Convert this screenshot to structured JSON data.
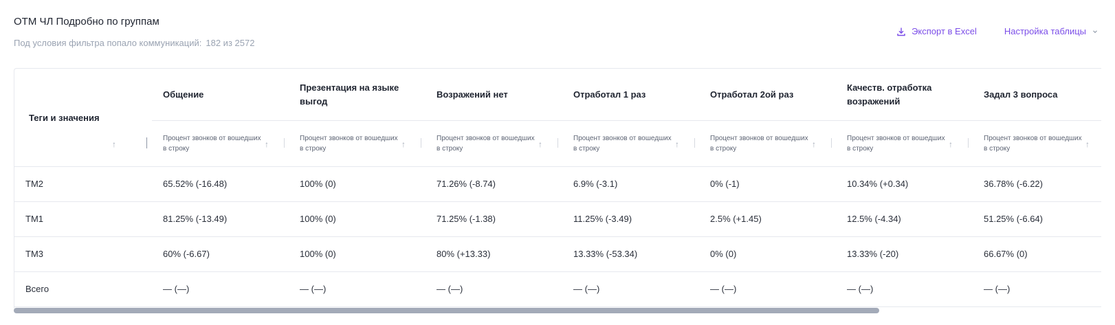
{
  "header": {
    "title": "ОТМ ЧЛ Подробно по группам",
    "filter_text": "Под условия фильтра попало коммуникаций:",
    "filter_count": "182 из 2572"
  },
  "actions": {
    "export_label": "Экспорт в Excel",
    "settings_label": "Настройка таблицы"
  },
  "colors": {
    "accent": "#7b4de8",
    "muted": "#9aa3b2",
    "border": "#e6e8ee",
    "scrollbar": "#a3aab8"
  },
  "table": {
    "row_header_label": "Теги и значения",
    "columns": [
      {
        "title": "Общение",
        "subtitle": "Процент звонков от вошедших в строку"
      },
      {
        "title": "Презентация на языке выгод",
        "subtitle": "Процент звонков от вошедших в строку"
      },
      {
        "title": "Возражений нет",
        "subtitle": "Процент звонков от вошедших в строку"
      },
      {
        "title": "Отработал 1 раз",
        "subtitle": "Процент звонков от вошедших в строку"
      },
      {
        "title": "Отработал 2ой раз",
        "subtitle": "Процент звонков от вошедших в строку"
      },
      {
        "title": "Качеств. отработка возражений",
        "subtitle": "Процент звонков от вошедших в строку"
      },
      {
        "title": "Задал 3 вопроса",
        "subtitle": "Процент звонков от вошедших в строку"
      }
    ],
    "rows": [
      {
        "label": "ТМ2",
        "cells": [
          "65.52% (-16.48)",
          "100% (0)",
          "71.26% (-8.74)",
          "6.9% (-3.1)",
          "0% (-1)",
          "10.34% (+0.34)",
          "36.78% (-6.22)"
        ]
      },
      {
        "label": "ТМ1",
        "cells": [
          "81.25% (-13.49)",
          "100% (0)",
          "71.25% (-1.38)",
          "11.25% (-3.49)",
          "2.5% (+1.45)",
          "12.5% (-4.34)",
          "51.25% (-6.64)"
        ]
      },
      {
        "label": "ТМ3",
        "cells": [
          "60% (-6.67)",
          "100% (0)",
          "80% (+13.33)",
          "13.33% (-53.34)",
          "0% (0)",
          "13.33% (-20)",
          "66.67% (0)"
        ]
      },
      {
        "label": "Всего",
        "cells": [
          "— (—)",
          "— (—)",
          "— (—)",
          "— (—)",
          "— (—)",
          "— (—)",
          "— (—)"
        ]
      }
    ]
  }
}
